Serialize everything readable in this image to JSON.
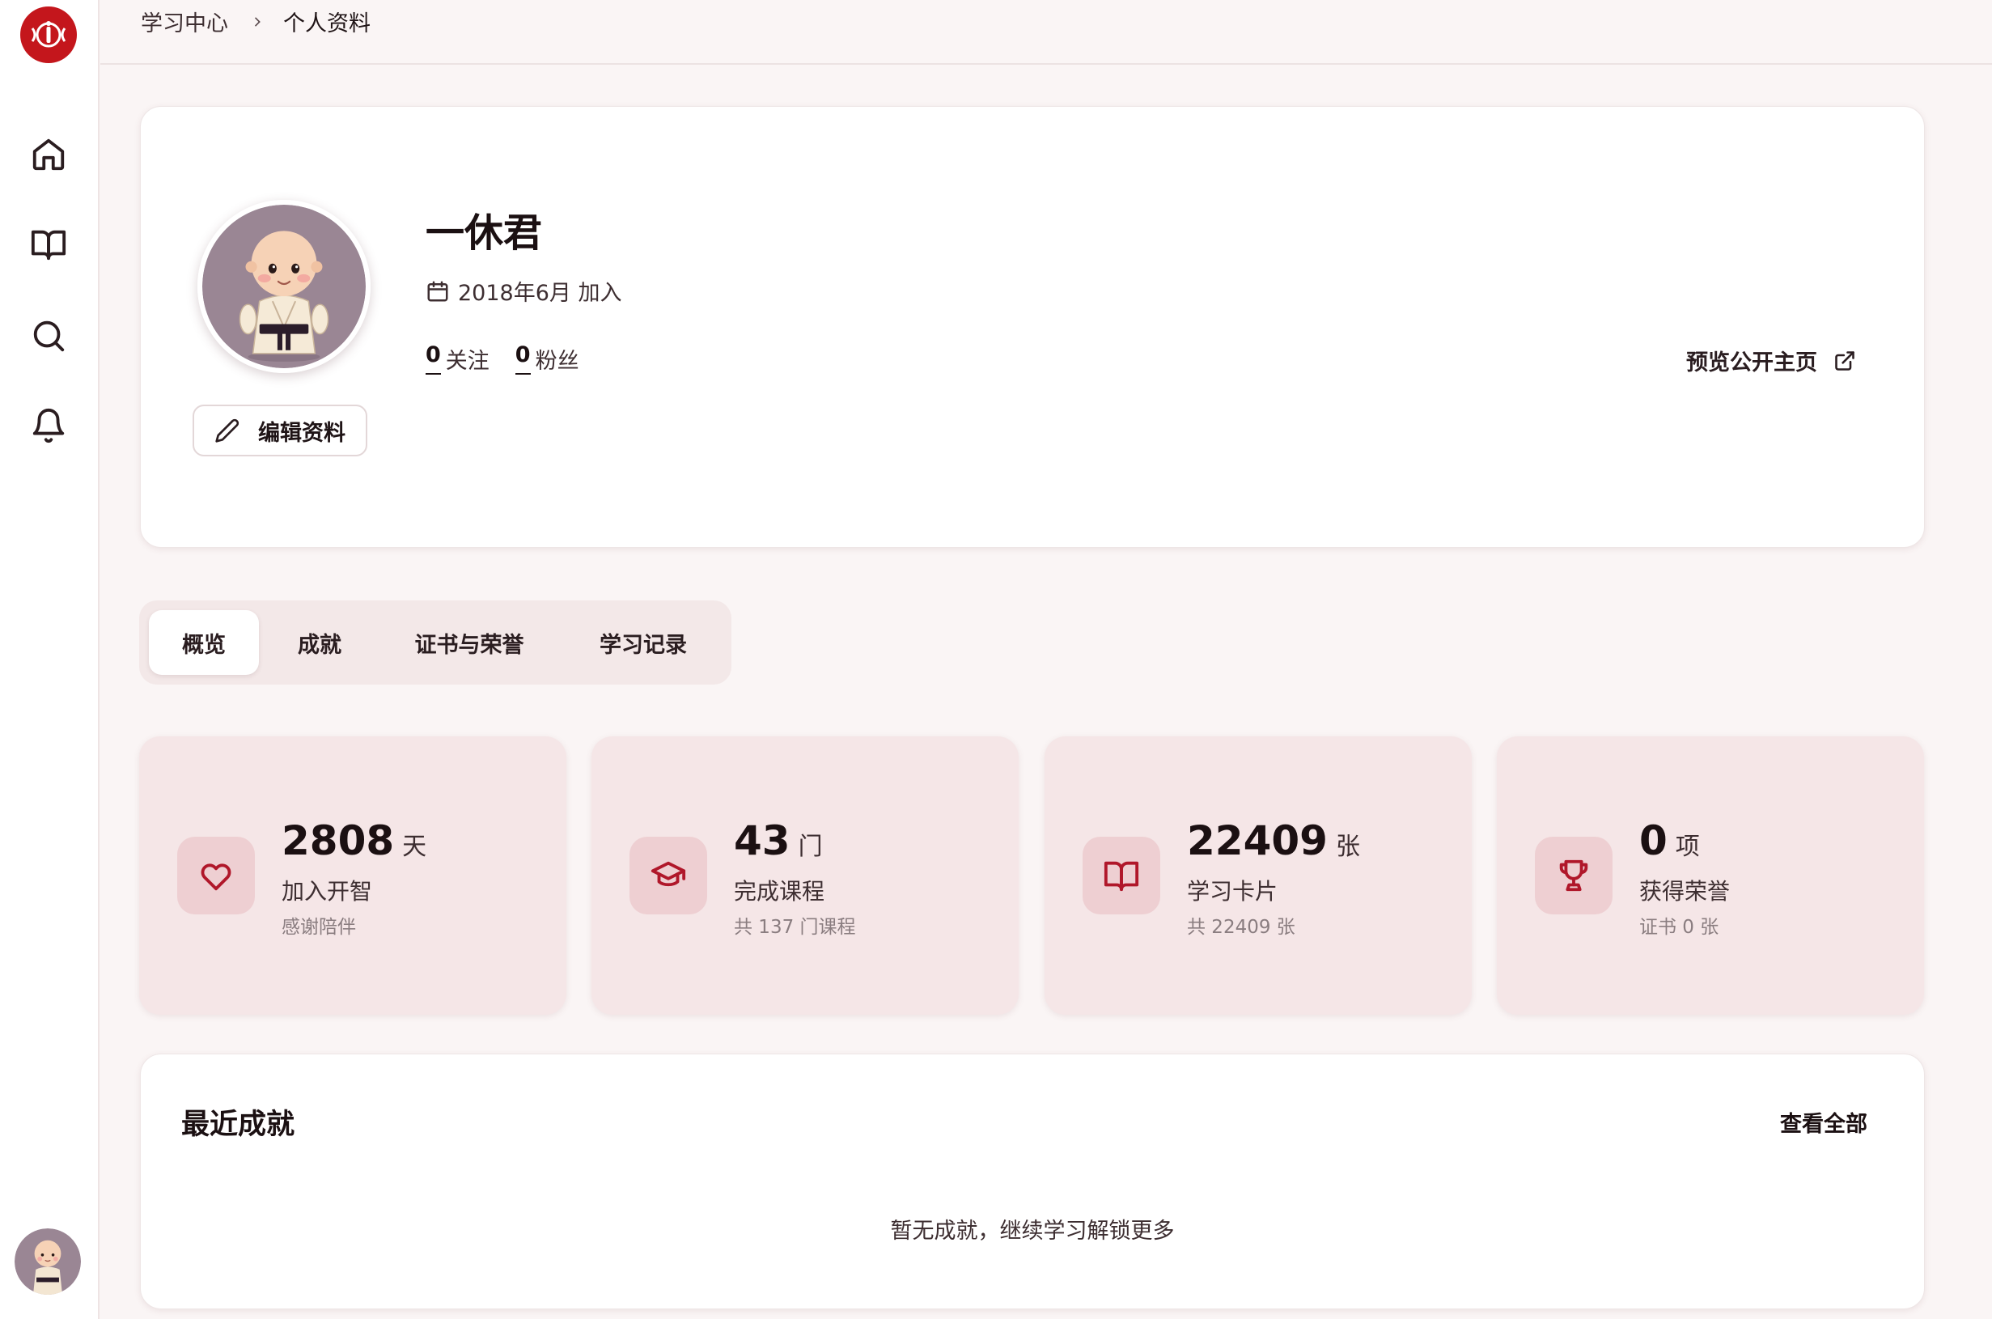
{
  "breadcrumb": {
    "root": "学习中心",
    "current": "个人资料"
  },
  "profile": {
    "name": "一休君",
    "joined": "2018年6月 加入",
    "following_count": "0",
    "following_label": "关注",
    "followers_count": "0",
    "followers_label": "粉丝",
    "edit_label": "编辑资料",
    "preview_label": "预览公开主页"
  },
  "tabs": [
    "概览",
    "成就",
    "证书与荣誉",
    "学习记录"
  ],
  "active_tab": "概览",
  "stats": [
    {
      "icon": "heart-icon",
      "value": "2808",
      "unit": "天",
      "label": "加入开智",
      "sub": "感谢陪伴"
    },
    {
      "icon": "graduation-cap-icon",
      "value": "43",
      "unit": "门",
      "label": "完成课程",
      "sub": "共 137 门课程"
    },
    {
      "icon": "book-open-icon",
      "value": "22409",
      "unit": "张",
      "label": "学习卡片",
      "sub": "共 22409 张"
    },
    {
      "icon": "trophy-icon",
      "value": "0",
      "unit": "项",
      "label": "获得荣誉",
      "sub": "证书 0 张"
    }
  ],
  "recent": {
    "title": "最近成就",
    "view_all": "查看全部",
    "empty": "暂无成就，继续学习解锁更多"
  },
  "colors": {
    "accent": "#b0172a",
    "card_bg": "#f5e6e7",
    "icon_bg": "#eecfd2",
    "page_bg": "#faf5f5"
  },
  "nav_icons": [
    "home-icon",
    "book-icon",
    "search-icon",
    "bell-icon"
  ]
}
